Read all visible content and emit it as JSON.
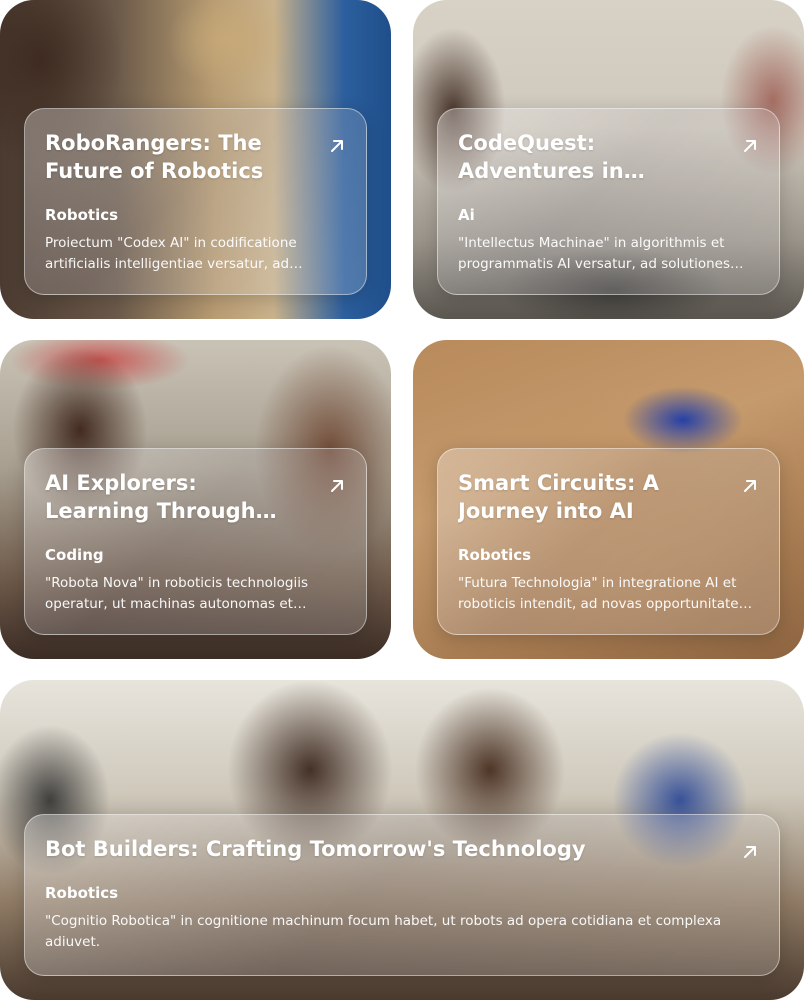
{
  "cards": [
    {
      "title": "RoboRangers: The Future of Robotics",
      "category": "Robotics",
      "description": "Proiectum \"Codex AI\" in codificatione artificialis intelligentiae versatur, ad automationem et innovationem promovendam."
    },
    {
      "title": "CodeQuest: Adventures in Programming",
      "category": "Ai",
      "description": "\"Intellectus Machinae\" in algorithmis et programmatis AI versatur, ad solutiones intelligentes creandas."
    },
    {
      "title": "AI Explorers: Learning Through Innovation",
      "category": "Coding",
      "description": "\"Robota Nova\" in roboticis technologiis operatur, ut machinas autonomas et interactivas construat."
    },
    {
      "title": "Smart Circuits: A Journey into AI",
      "category": "Robotics",
      "description": "\"Futura Technologia\" in integratione AI et roboticis intendit, ad novas opportunitates creandas."
    },
    {
      "title": "Bot Builders: Crafting Tomorrow's Technology",
      "category": "Robotics",
      "description": "\"Cognitio Robotica\" in cognitione machinum focum habet, ut robots ad opera cotidiana et complexa adiuvet."
    }
  ]
}
